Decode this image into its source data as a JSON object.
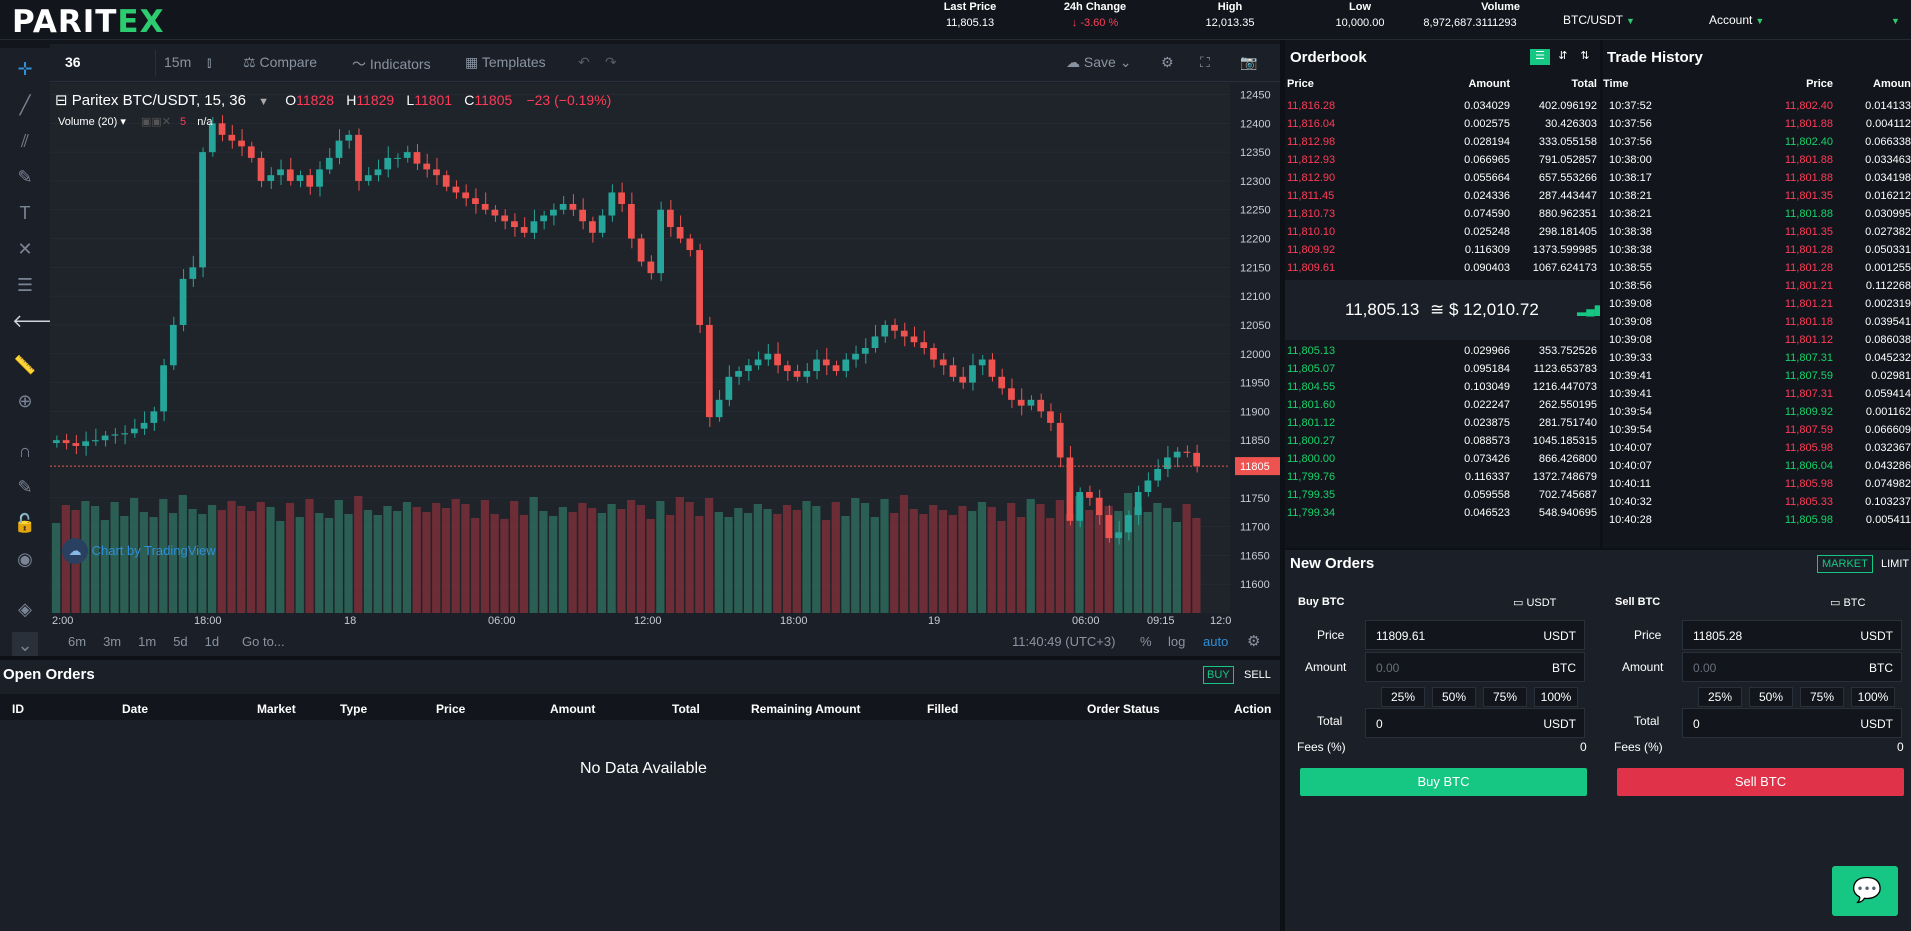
{
  "brand": {
    "logo_main": "PARIT",
    "logo_x": "EX"
  },
  "ticker": {
    "last_price_label": "Last Price",
    "last_price": "11,805.13",
    "change_label": "24h Change",
    "change": "-3.60 %",
    "change_icon": "arrow-down-icon",
    "high_label": "High",
    "high": "12,013.35",
    "low_label": "Low",
    "low": "10,000.00",
    "volume_label": "Volume",
    "volume": "8,972,687.3111293"
  },
  "topnav": {
    "pair": "BTC/USDT",
    "account": "Account"
  },
  "chart_toolbar": {
    "symbol_input": "36",
    "interval": "15m",
    "compare": "Compare",
    "indicators": "Indicators",
    "templates": "Templates",
    "save": "Save"
  },
  "chart_legend": {
    "title": "Paritex BTC/USDT, 15, 36",
    "o_label": "O",
    "o": "11828",
    "h_label": "H",
    "h": "11829",
    "l_label": "L",
    "l": "11801",
    "c_label": "C",
    "c": "11805",
    "change": "−23 (−0.19%)",
    "volume": "Volume (20)",
    "volume_val": "5",
    "volume_na": "n/a"
  },
  "chart_watermark": "Chart by TradingView",
  "chart_data": {
    "type": "candlestick",
    "ylim": [
      11550,
      12470
    ],
    "price_ticks": [
      "12450",
      "12400",
      "12350",
      "12300",
      "12250",
      "12200",
      "12150",
      "12100",
      "12050",
      "12000",
      "11950",
      "11900",
      "11850",
      "11805",
      "11750",
      "11700",
      "11650",
      "11600"
    ],
    "current_price": "11805",
    "time_ticks": [
      "2:00",
      "18:00",
      "18",
      "06:00",
      "12:00",
      "18:00",
      "19",
      "06:00",
      "09:15",
      "12:0"
    ],
    "close_path": [
      11850,
      11845,
      11840,
      11848,
      11850,
      11858,
      11860,
      11862,
      11870,
      11880,
      11900,
      11980,
      12050,
      12130,
      12150,
      12350,
      12400,
      12380,
      12370,
      12360,
      12340,
      12300,
      12310,
      12320,
      12300,
      12310,
      12290,
      12320,
      12340,
      12370,
      12380,
      12300,
      12310,
      12320,
      12340,
      12340,
      12350,
      12330,
      12320,
      12310,
      12290,
      12280,
      12270,
      12260,
      12250,
      12240,
      12230,
      12220,
      12210,
      12230,
      12240,
      12250,
      12260,
      12250,
      12230,
      12210,
      12240,
      12280,
      12260,
      12200,
      12160,
      12140,
      12250,
      12220,
      12200,
      12180,
      12050,
      11890,
      11920,
      11960,
      11970,
      11980,
      11990,
      12000,
      11980,
      11970,
      11960,
      11970,
      11990,
      11980,
      11970,
      11990,
      12000,
      12010,
      12030,
      12050,
      12040,
      12030,
      12020,
      12010,
      11990,
      11980,
      11960,
      11950,
      11980,
      11990,
      11960,
      11940,
      11920,
      11910,
      11920,
      11900,
      11880,
      11820,
      11710,
      11760,
      11750,
      11720,
      11680,
      11690,
      11720,
      11760,
      11780,
      11800,
      11820,
      11830,
      11828,
      11805
    ]
  },
  "chart_bottom": {
    "ranges": [
      "6m",
      "3m",
      "1m",
      "5d",
      "1d"
    ],
    "goto": "Go to...",
    "clock": "11:40:49 (UTC+3)",
    "percent": "%",
    "log": "log",
    "auto": "auto"
  },
  "orderbook": {
    "title": "Orderbook",
    "headers": {
      "price": "Price",
      "amount": "Amount",
      "total": "Total"
    },
    "asks": [
      [
        "11,816.28",
        "0.034029",
        "402.096192"
      ],
      [
        "11,816.04",
        "0.002575",
        "30.426303"
      ],
      [
        "11,812.98",
        "0.028194",
        "333.055158"
      ],
      [
        "11,812.93",
        "0.066965",
        "791.052857"
      ],
      [
        "11,812.90",
        "0.055664",
        "657.553266"
      ],
      [
        "11,811.45",
        "0.024336",
        "287.443447"
      ],
      [
        "11,810.73",
        "0.074590",
        "880.962351"
      ],
      [
        "11,810.10",
        "0.025248",
        "298.181405"
      ],
      [
        "11,809.92",
        "0.116309",
        "1373.599985"
      ],
      [
        "11,809.61",
        "0.090403",
        "1067.624173"
      ]
    ],
    "mid_price": "11,805.13",
    "mid_fiat": "≅ $ 12,010.72",
    "bids": [
      [
        "11,805.13",
        "0.029966",
        "353.752526"
      ],
      [
        "11,805.07",
        "0.095184",
        "1123.653783"
      ],
      [
        "11,804.55",
        "0.103049",
        "1216.447073"
      ],
      [
        "11,801.60",
        "0.022247",
        "262.550195"
      ],
      [
        "11,801.12",
        "0.023875",
        "281.751740"
      ],
      [
        "11,800.27",
        "0.088573",
        "1045.185315"
      ],
      [
        "11,800.00",
        "0.073426",
        "866.426800"
      ],
      [
        "11,799.76",
        "0.116337",
        "1372.748679"
      ],
      [
        "11,799.35",
        "0.059558",
        "702.745687"
      ],
      [
        "11,799.34",
        "0.046523",
        "548.940695"
      ]
    ]
  },
  "trade_history": {
    "title": "Trade History",
    "headers": {
      "time": "Time",
      "price": "Price",
      "amount": "Amoun"
    },
    "rows": [
      [
        "10:37:52",
        "11,802.40",
        "0.014133",
        "sell"
      ],
      [
        "10:37:56",
        "11,801.88",
        "0.004112",
        "sell"
      ],
      [
        "10:37:56",
        "11,802.40",
        "0.066338",
        "buy"
      ],
      [
        "10:38:00",
        "11,801.88",
        "0.033463",
        "sell"
      ],
      [
        "10:38:17",
        "11,801.88",
        "0.034198",
        "sell"
      ],
      [
        "10:38:21",
        "11,801.35",
        "0.016212",
        "sell"
      ],
      [
        "10:38:21",
        "11,801.88",
        "0.030995",
        "buy"
      ],
      [
        "10:38:38",
        "11,801.35",
        "0.027382",
        "sell"
      ],
      [
        "10:38:38",
        "11,801.28",
        "0.050331",
        "sell"
      ],
      [
        "10:38:55",
        "11,801.28",
        "0.001255",
        "sell"
      ],
      [
        "10:38:56",
        "11,801.21",
        "0.112268",
        "sell"
      ],
      [
        "10:39:08",
        "11,801.21",
        "0.002319",
        "sell"
      ],
      [
        "10:39:08",
        "11,801.18",
        "0.039541",
        "sell"
      ],
      [
        "10:39:08",
        "11,801.12",
        "0.086038",
        "sell"
      ],
      [
        "10:39:33",
        "11,807.31",
        "0.045232",
        "buy"
      ],
      [
        "10:39:41",
        "11,807.59",
        "0.02981",
        "buy"
      ],
      [
        "10:39:41",
        "11,807.31",
        "0.059414",
        "sell"
      ],
      [
        "10:39:54",
        "11,809.92",
        "0.001162",
        "buy"
      ],
      [
        "10:39:54",
        "11,807.59",
        "0.066609",
        "sell"
      ],
      [
        "10:40:07",
        "11,805.98",
        "0.032367",
        "sell"
      ],
      [
        "10:40:07",
        "11,806.04",
        "0.043286",
        "buy"
      ],
      [
        "10:40:11",
        "11,805.98",
        "0.074982",
        "sell"
      ],
      [
        "10:40:32",
        "11,805.33",
        "0.103237",
        "sell"
      ],
      [
        "10:40:28",
        "11,805.98",
        "0.005411",
        "buy"
      ]
    ]
  },
  "new_orders": {
    "title": "New Orders",
    "market": "MARKET",
    "limit": "LIMIT",
    "buy": {
      "title": "Buy BTC",
      "balance": "USDT",
      "price_label": "Price",
      "price": "11809.61",
      "price_unit": "USDT",
      "amount_label": "Amount",
      "amount_placeholder": "0.00",
      "amount_unit": "BTC",
      "pcts": [
        "25%",
        "50%",
        "75%",
        "100%"
      ],
      "total_label": "Total",
      "total": "0",
      "total_unit": "USDT",
      "fees_label": "Fees (%)",
      "fees": "0",
      "button": "Buy BTC"
    },
    "sell": {
      "title": "Sell BTC",
      "balance": "BTC",
      "price_label": "Price",
      "price": "11805.28",
      "price_unit": "USDT",
      "amount_label": "Amount",
      "amount_placeholder": "0.00",
      "amount_unit": "BTC",
      "pcts": [
        "25%",
        "50%",
        "75%",
        "100%"
      ],
      "total_label": "Total",
      "total": "0",
      "total_unit": "USDT",
      "fees_label": "Fees (%)",
      "fees": "0",
      "button": "Sell BTC"
    }
  },
  "open_orders": {
    "title": "Open Orders",
    "buy": "BUY",
    "sell": "SELL",
    "columns": [
      "ID",
      "Date",
      "Market",
      "Type",
      "Price",
      "Amount",
      "Total",
      "Remaining Amount",
      "Filled",
      "Order Status",
      "Action"
    ],
    "empty": "No Data Available"
  },
  "colors": {
    "accent": "#16c784",
    "down": "#ff3b57",
    "bg": "#12161c",
    "panel": "#1b2028"
  }
}
